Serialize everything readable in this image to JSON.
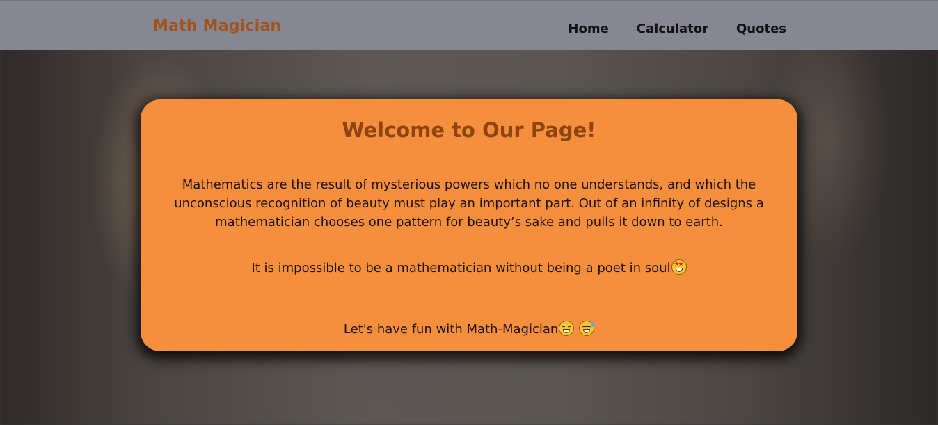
{
  "navbar": {
    "brand": "Math Magician",
    "links": [
      "Home",
      "Calculator",
      "Quotes"
    ]
  },
  "card": {
    "title": "Welcome to Our Page!",
    "quote": "Mathematics are the result of mysterious powers which no one understands, and which the unconscious recognition of beauty must play an important part. Out of an infinity of designs a mathematician chooses one pattern for beauty’s sake and pulls it down to earth.",
    "line2": "It is impossible to be a mathematician without being a poet in soul",
    "line3": "Let's have fun with Math-Magician"
  },
  "icons": {
    "line2_emoji": "star-struck-emoji-icon",
    "line3_emojis": [
      "grinning-emoji-icon",
      "grinning-sweat-emoji-icon"
    ]
  },
  "colors": {
    "navbar_bg": "#868793",
    "brand": "#a2531a",
    "card_bg": "#f58f3e",
    "card_title": "#8c4511"
  }
}
